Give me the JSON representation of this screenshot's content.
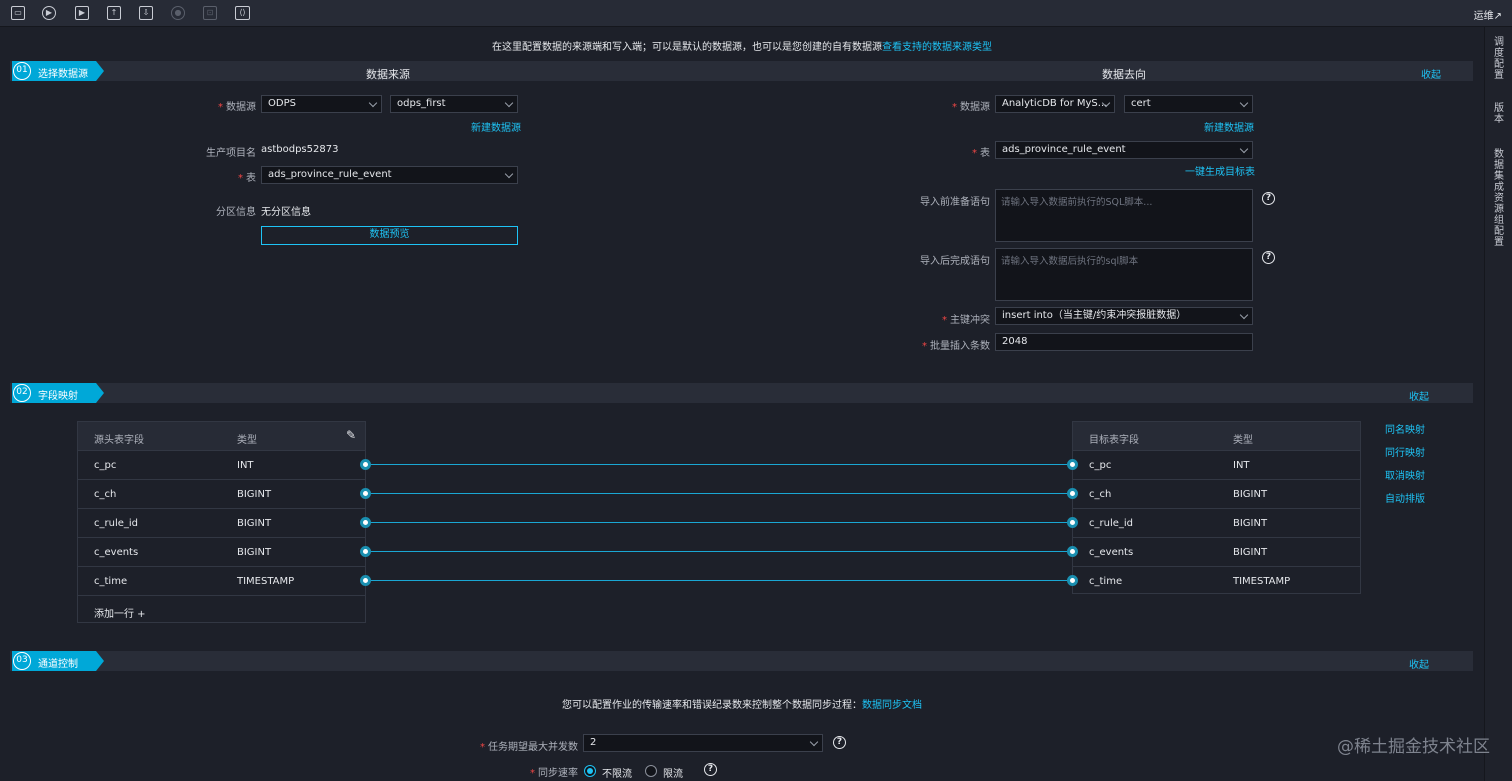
{
  "toolbar": {
    "icons": [
      "save-icon",
      "run-icon",
      "run-with-params-icon",
      "submit-icon",
      "publish-icon",
      "stop-icon",
      "lock-icon",
      "code-mode-icon"
    ],
    "ops_label": "运维↗"
  },
  "side_tabs": [
    "调度配置",
    "版本",
    "数据集成资源组配置"
  ],
  "notice": {
    "text": "在这里配置数据的来源端和写入端；可以是默认的数据源，也可以是您创建的自有数据源",
    "link": "查看支持的数据来源类型"
  },
  "section1": {
    "num": "01",
    "title": "选择数据源",
    "collapse": "收起",
    "source": {
      "heading": "数据来源",
      "datasource_label": "数据源",
      "datasource_type": "ODPS",
      "datasource_name": "odps_first",
      "new_datasource": "新建数据源",
      "project_label": "生产项目名",
      "project_value": "astbodps52873",
      "table_label": "表",
      "table_value": "ads_province_rule_event",
      "partition_label": "分区信息",
      "partition_value": "无分区信息",
      "preview_button": "数据预览"
    },
    "target": {
      "heading": "数据去向",
      "datasource_label": "数据源",
      "datasource_type": "AnalyticDB for MyS...",
      "datasource_name": "cert",
      "new_datasource": "新建数据源",
      "table_label": "表",
      "table_value": "ads_province_rule_event",
      "gen_table": "一键生成目标表",
      "pre_sql_label": "导入前准备语句",
      "pre_sql_placeholder": "请输入导入数据前执行的SQL脚本...",
      "post_sql_label": "导入后完成语句",
      "post_sql_placeholder": "请输入导入数据后执行的sql脚本",
      "conflict_label": "主键冲突",
      "conflict_value": "insert into（当主键/约束冲突报脏数据）",
      "batch_label": "批量插入条数",
      "batch_value": "2048"
    }
  },
  "section2": {
    "num": "02",
    "title": "字段映射",
    "collapse": "收起",
    "source_headers": [
      "源头表字段",
      "类型"
    ],
    "target_headers": [
      "目标表字段",
      "类型"
    ],
    "source_rows": [
      {
        "field": "c_pc",
        "type": "INT"
      },
      {
        "field": "c_ch",
        "type": "BIGINT"
      },
      {
        "field": "c_rule_id",
        "type": "BIGINT"
      },
      {
        "field": "c_events",
        "type": "BIGINT"
      },
      {
        "field": "c_time",
        "type": "TIMESTAMP"
      }
    ],
    "target_rows": [
      {
        "field": "c_pc",
        "type": "INT"
      },
      {
        "field": "c_ch",
        "type": "BIGINT"
      },
      {
        "field": "c_rule_id",
        "type": "BIGINT"
      },
      {
        "field": "c_events",
        "type": "BIGINT"
      },
      {
        "field": "c_time",
        "type": "TIMESTAMP"
      }
    ],
    "add_row": "添加一行 +",
    "actions": [
      "同名映射",
      "同行映射",
      "取消映射",
      "自动排版"
    ]
  },
  "section3": {
    "num": "03",
    "title": "通道控制",
    "collapse": "收起",
    "notice": "您可以配置作业的传输速率和错误纪录数来控制整个数据同步过程：",
    "notice_link": "数据同步文档",
    "concurrency_label": "任务期望最大并发数",
    "concurrency_value": "2",
    "speed_label": "同步速率",
    "speed_options": [
      "不限流",
      "限流"
    ],
    "speed_selected": "不限流"
  },
  "watermark": "@稀土掘金技术社区"
}
